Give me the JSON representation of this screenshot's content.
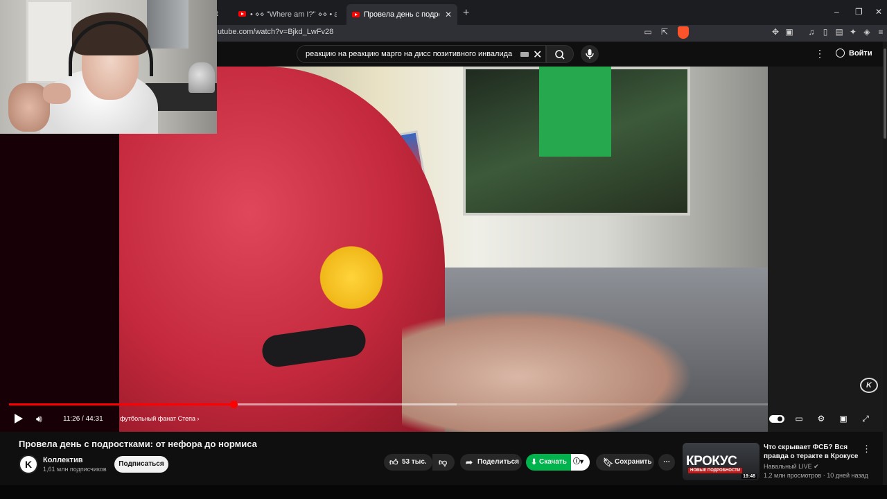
{
  "browser": {
    "tabs": [
      {
        "label": "• ⋄⋄ \"Where am I?\" ⋄⋄ • a dreamcore"
      },
      {
        "label": "Провела день с подростками: от"
      }
    ],
    "partial_tab_text": "ert",
    "url": "utube.com/watch?v=Bjkd_LwFv28"
  },
  "youtube": {
    "search": {
      "query": "реакцию на реакцию марго на дисс позитивного инвалида"
    },
    "signin_label": "Войти"
  },
  "player": {
    "progress_fraction": 0.2955,
    "buffered_fraction": 0.59,
    "time_label": "11:26 / 44:31",
    "chapter_label": "футбольный фанат Степа",
    "watermark": "K"
  },
  "video": {
    "title": "Провела день с подростками: от нефора до нормиса",
    "channel": {
      "name": "Коллектив",
      "subscribers": "1,61 млн подписчиков",
      "avatar_letter": "K"
    },
    "subscribe_label": "Подписаться",
    "like_count": "53 тыс.",
    "share_label": "Поделиться",
    "download_label": "Скачать",
    "save_label": "Сохранить"
  },
  "recommendation": {
    "title": "Что скрывает ФСБ? Вся правда о теракте в Крокусе",
    "channel": "Навальный LIVE",
    "meta": "1,2 млн просмотров · 10 дней назад",
    "duration": "19:48",
    "thumb_text": "КРОКУС",
    "thumb_subtext": "НОВЫЕ ПОДРОБНОСТИ"
  },
  "colors": {
    "accent": "#ff0000",
    "download_green": "#00b34d",
    "background": "#0f0f0f"
  },
  "icons": [
    "youtube-favicon",
    "close-icon",
    "new-tab-icon",
    "minimize-icon",
    "maximize-icon",
    "cast-icon",
    "share-icon",
    "brave-shield-icon",
    "extensions-icon",
    "search-icon",
    "mic-icon",
    "more-vertical-icon",
    "user-circle-icon",
    "play-icon",
    "volume-icon",
    "chevron-right-icon",
    "autoplay-toggle-icon",
    "subtitles-icon",
    "settings-icon",
    "miniplayer-icon",
    "fullscreen-icon",
    "thumbs-up-icon",
    "thumbs-down-icon",
    "download-icon",
    "info-icon",
    "bookmark-icon",
    "more-horizontal-icon",
    "verified-icon"
  ]
}
